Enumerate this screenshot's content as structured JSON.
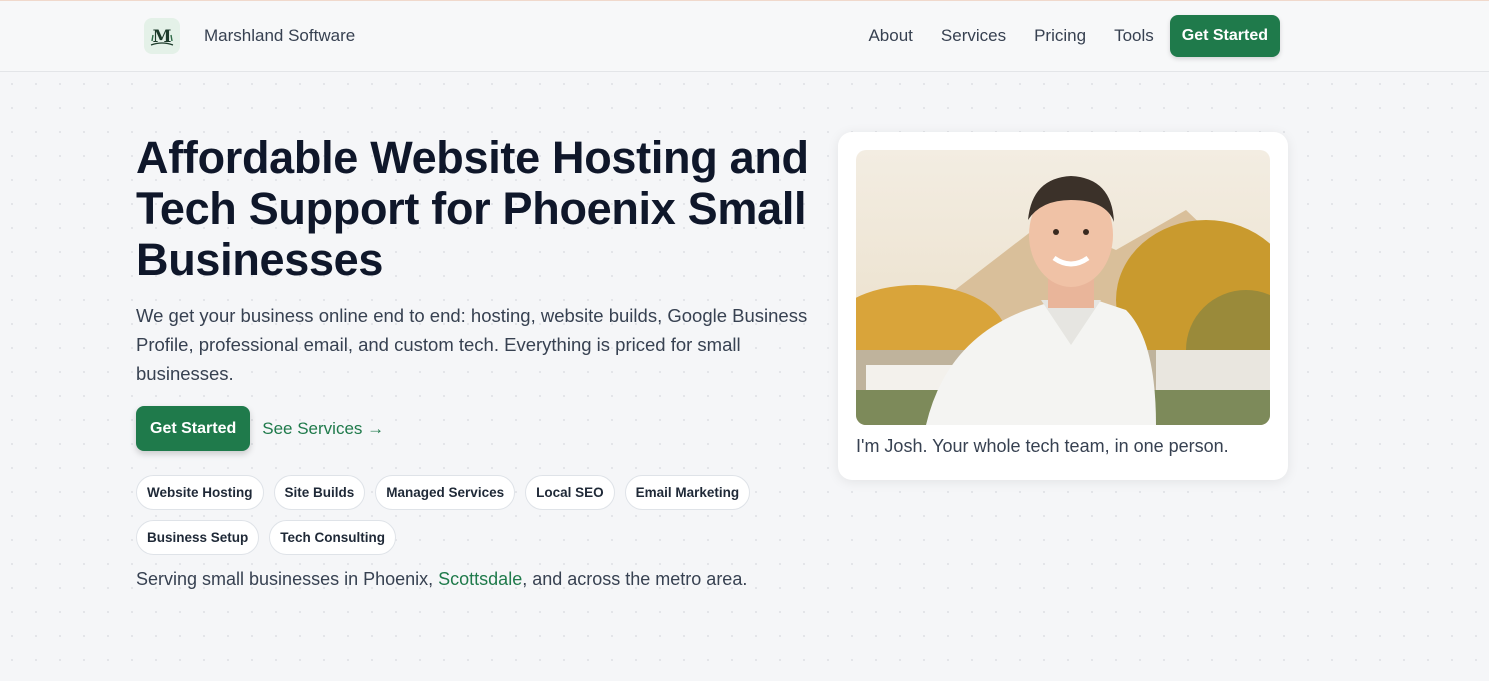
{
  "header": {
    "brand_name": "Marshland Software",
    "logo_mark": "M",
    "nav": [
      "About",
      "Services",
      "Pricing",
      "Tools"
    ],
    "cta_label": "Get Started"
  },
  "hero": {
    "title": "Affordable Website Hosting and Tech Support for Phoenix Small Businesses",
    "description": "We get your business online end to end: hosting, website builds, Google Business Profile, professional email, and custom tech. Everything is priced for small businesses.",
    "primary_cta": "Get Started",
    "secondary_cta": "See Services →",
    "tags": [
      "Website Hosting",
      "Site Builds",
      "Managed Services",
      "Local SEO",
      "Email Marketing",
      "Business Setup",
      "Tech Consulting"
    ],
    "serving_prefix": "Serving small businesses in Phoenix, ",
    "serving_city": "Scottsdale",
    "serving_suffix": ", and across the metro area."
  },
  "card": {
    "caption": "I'm Josh. Your whole tech team, in one person."
  },
  "colors": {
    "accent": "#1f7a4b",
    "heading": "#0f172a",
    "background": "#f5f6f8"
  }
}
